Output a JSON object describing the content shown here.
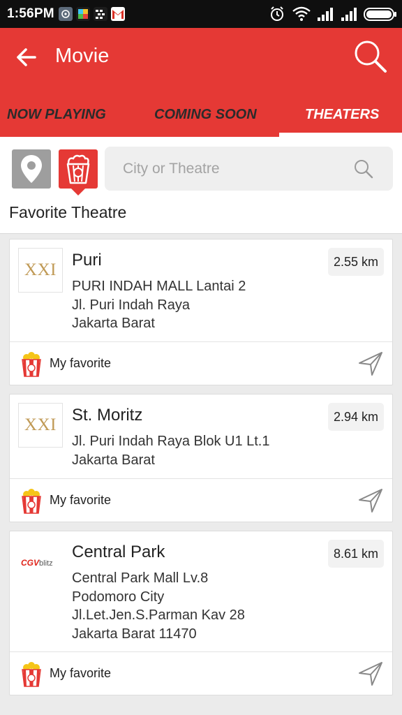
{
  "status_bar": {
    "time": "1:56PM"
  },
  "header": {
    "title": "Movie"
  },
  "tabs": [
    {
      "label": "NOW PLAYING"
    },
    {
      "label": "COMING SOON"
    },
    {
      "label": "THEATERS"
    }
  ],
  "search": {
    "placeholder": "City or Theatre"
  },
  "section_title": "Favorite Theatre",
  "theatres": [
    {
      "name": "Puri",
      "logo_text": "XXI",
      "distance": "2.55 km",
      "address": [
        "PURI INDAH MALL Lantai 2",
        "Jl. Puri Indah Raya",
        "Jakarta Barat"
      ],
      "favorite_label": "My favorite"
    },
    {
      "name": "St. Moritz",
      "logo_text": "XXI",
      "distance": "2.94 km",
      "address": [
        "Jl. Puri Indah Raya Blok U1 Lt.1",
        "Jakarta Barat"
      ],
      "favorite_label": "My favorite"
    },
    {
      "name": "Central Park",
      "logo_text": "CGV",
      "logo_sub": "blitz",
      "distance": "8.61 km",
      "address": [
        "Central Park Mall Lv.8",
        "Podomoro City",
        "Jl.Let.Jen.S.Parman Kav 28",
        "Jakarta Barat 11470"
      ],
      "favorite_label": "My favorite"
    }
  ],
  "colors": {
    "accent": "#e53935",
    "status_bar": "#0f0f0f",
    "logo_gold": "#c09a56"
  },
  "icons": [
    "back-arrow-icon",
    "search-icon",
    "location-pin-icon",
    "popcorn-icon",
    "navigate-icon"
  ]
}
